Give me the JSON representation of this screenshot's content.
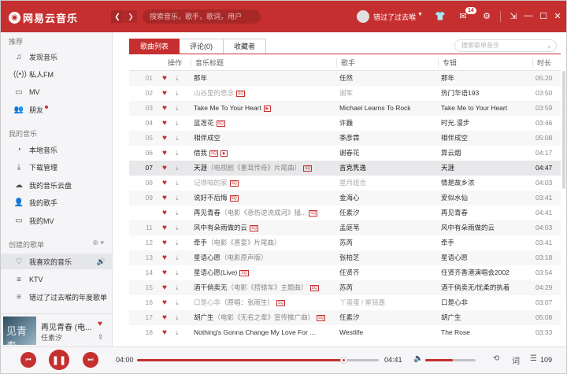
{
  "header": {
    "logo_text": "网易云音乐",
    "back_icon": "chevron-left-icon",
    "forward_icon": "chevron-right-icon",
    "search_placeholder": "搜索音乐，歌手，歌词，用户",
    "username": "错过了过去喉",
    "msg_count": "14",
    "accent_color": "#c62f2f"
  },
  "sidebar": {
    "section_recommend": "推荐",
    "recommend_items": [
      {
        "label": "发现音乐",
        "icon": "music-note-icon"
      },
      {
        "label": "私人FM",
        "icon": "radio-icon"
      },
      {
        "label": "MV",
        "icon": "video-icon"
      },
      {
        "label": "朋友",
        "icon": "friends-icon"
      }
    ],
    "section_my_music": "我的音乐",
    "my_music_items": [
      {
        "label": "本地音乐",
        "icon": "disc-icon"
      },
      {
        "label": "下载管理",
        "icon": "download-icon"
      },
      {
        "label": "我的音乐云盘",
        "icon": "cloud-icon"
      },
      {
        "label": "我的歌手",
        "icon": "user-icon"
      },
      {
        "label": "我的MV",
        "icon": "video-icon"
      }
    ],
    "section_created": "创建的歌单",
    "created_items": [
      {
        "label": "我喜欢的音乐",
        "icon": "heart-icon"
      },
      {
        "label": "KTV",
        "icon": "playlist-icon"
      },
      {
        "label": "错过了过去喉的年度歌单",
        "icon": "playlist-icon"
      }
    ]
  },
  "now_playing": {
    "cover_text": "见青春",
    "title": "再见青春 (电...",
    "artist": "任素汐"
  },
  "tabs": [
    {
      "label": "歌曲列表",
      "active": true
    },
    {
      "label": "评论(0)",
      "active": false
    },
    {
      "label": "收藏者",
      "active": false
    }
  ],
  "song_search_placeholder": "搜索歌单音乐",
  "columns": {
    "ops": "操作",
    "title": "音乐标题",
    "artist": "歌手",
    "album": "专辑",
    "duration": "时长"
  },
  "songs": [
    {
      "no": "01",
      "title": "那年",
      "sub": "",
      "sq": false,
      "mv": false,
      "artist": "任然",
      "album": "那年",
      "time": "05:20"
    },
    {
      "no": "02",
      "title": "山谷里的思念",
      "sub": "",
      "sq": true,
      "mv": false,
      "artist": "谢军",
      "album": "热门华语193",
      "time": "03:50",
      "grey": true
    },
    {
      "no": "03",
      "title": "Take Me To Your Heart",
      "sub": "",
      "sq": false,
      "mv": true,
      "artist": "Michael Learns To Rock",
      "album": "Take Me to Your Heart",
      "time": "03:59"
    },
    {
      "no": "04",
      "title": "蓝莲花",
      "sub": "",
      "sq": true,
      "mv": false,
      "artist": "许巍",
      "album": "时光.漫步",
      "time": "03:46"
    },
    {
      "no": "05",
      "title": "相伴成空",
      "sub": "",
      "sq": false,
      "mv": false,
      "artist": "季彦霖",
      "album": "相伴成空",
      "time": "05:08"
    },
    {
      "no": "06",
      "title": "借我",
      "sub": "",
      "sq": true,
      "mv": true,
      "artist": "谢春花",
      "album": "算云烟",
      "time": "04:17"
    },
    {
      "no": "07",
      "title": "天涯",
      "sub": "（电视剧《重耳传奇》片尾曲）",
      "sq": true,
      "mv": false,
      "artist": "吉克隽逸",
      "album": "天涯",
      "time": "04:47",
      "playing_row": true
    },
    {
      "no": "08",
      "title": "记得咱的家",
      "sub": "",
      "sq": true,
      "mv": false,
      "artist": "星月组合",
      "album": "情是故乡浓",
      "time": "04:03",
      "grey": true
    },
    {
      "no": "09",
      "title": "说好不后悔",
      "sub": "",
      "sq": true,
      "mv": false,
      "artist": "金海心",
      "album": "爱似水仙",
      "time": "03:41"
    },
    {
      "no": "10",
      "title": "再见青春",
      "sub": "（电影《悲伤逆流成河》插...",
      "sq": true,
      "mv": false,
      "artist": "任素汐",
      "album": "再见青春",
      "time": "04:41",
      "now": true
    },
    {
      "no": "11",
      "title": "风中有朵雨做的云",
      "sub": "",
      "sq": true,
      "mv": false,
      "artist": "孟庭苇",
      "album": "风中有朵雨做的云",
      "time": "04:03"
    },
    {
      "no": "12",
      "title": "牵手",
      "sub": "（电影《喜宴》片尾曲）",
      "sq": false,
      "mv": false,
      "artist": "苏芮",
      "album": "牵手",
      "time": "03:41"
    },
    {
      "no": "13",
      "title": "星语心愿",
      "sub": "（电影原声版）",
      "sq": false,
      "mv": false,
      "artist": "张柏芝",
      "album": "星语心愿",
      "time": "03:18"
    },
    {
      "no": "14",
      "title": "星语心愿(Live)",
      "sub": "",
      "sq": true,
      "mv": false,
      "artist": "任贤齐",
      "album": "任贤齐香港演唱会2002",
      "time": "03:54"
    },
    {
      "no": "15",
      "title": "酒干倘卖无",
      "sub": "（电影《搭错车》主题曲）",
      "sq": true,
      "mv": false,
      "artist": "苏芮",
      "album": "酒干倘卖无/忧柔的执着",
      "time": "04:29"
    },
    {
      "no": "16",
      "title": "口是心非",
      "sub": "（原唱：张雨生）",
      "sq": true,
      "mv": false,
      "artist": "丫蛋蛋 / 崔铭嘉",
      "album": "口是心非",
      "time": "03:07",
      "grey": true
    },
    {
      "no": "17",
      "title": "胡广生",
      "sub": "（电影《无名之辈》宣传推广曲）",
      "sq": true,
      "mv": false,
      "artist": "任素汐",
      "album": "胡广生",
      "time": "05:08"
    },
    {
      "no": "18",
      "title": "Nothing's Gonna Change My Love For ...",
      "sub": "",
      "sq": false,
      "mv": false,
      "artist": "Westlife",
      "album": "The Rose",
      "time": "03:33"
    }
  ],
  "tag_sq": "SQ",
  "tag_mv": "▶",
  "player": {
    "current_time": "04:00",
    "total_time": "04:41",
    "progress": 0.853,
    "volume": 0.55,
    "playlist_count": "109"
  }
}
